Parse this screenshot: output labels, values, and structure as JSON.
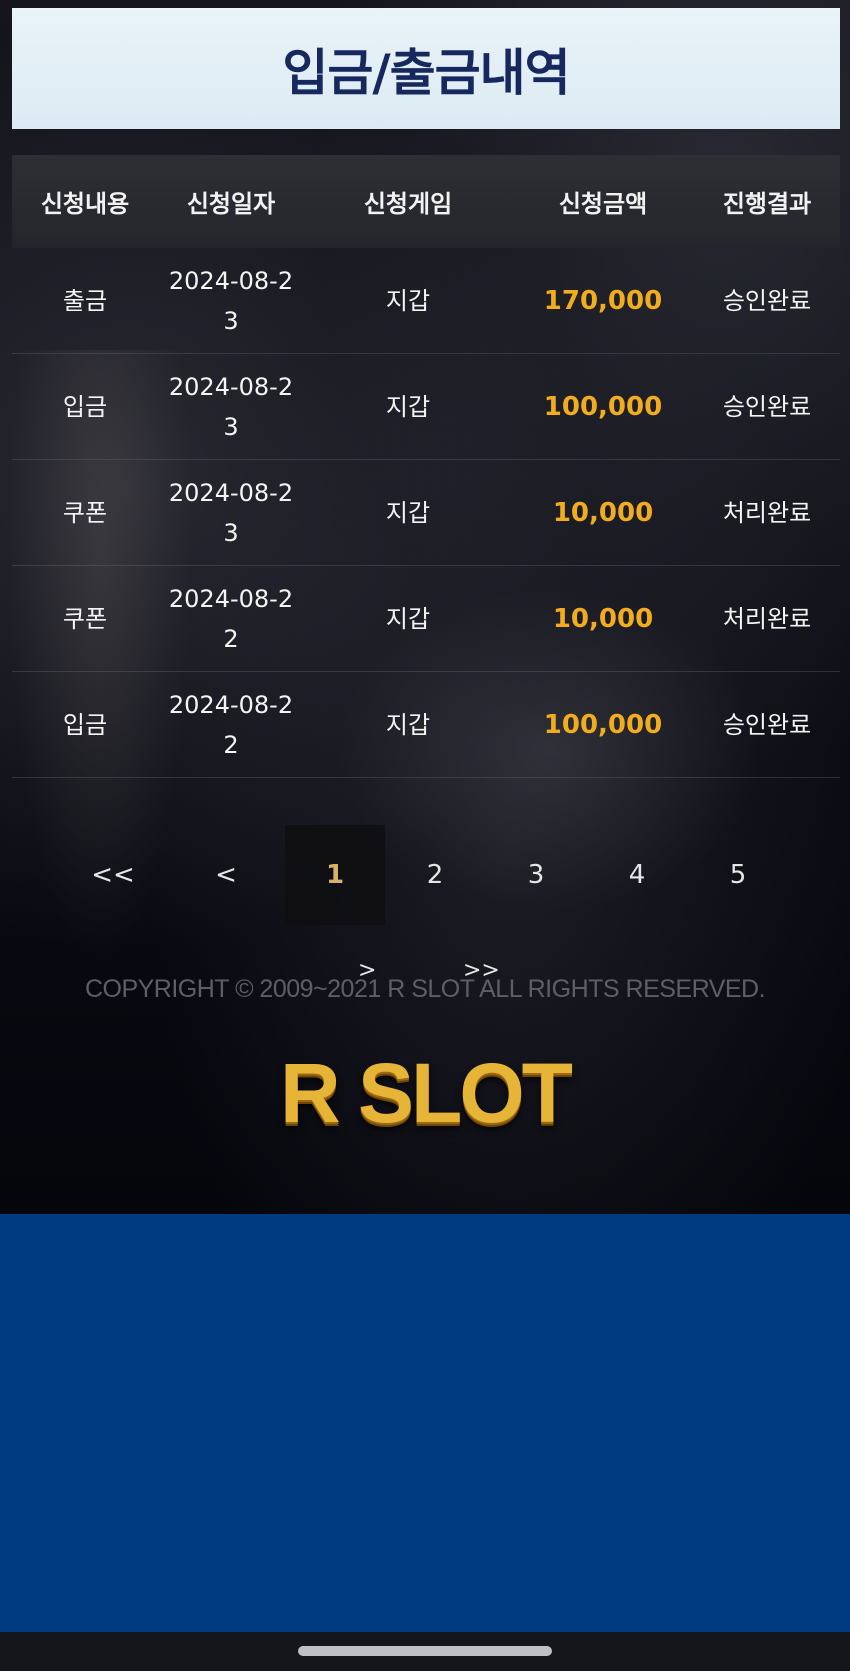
{
  "header": {
    "title": "입금/출금내역"
  },
  "table": {
    "columns": [
      "신청내용",
      "신청일자",
      "신청게임",
      "신청금액",
      "진행결과"
    ],
    "rows": [
      {
        "type": "출금",
        "date": "2024-08-23",
        "game": "지갑",
        "amount": "170,000",
        "status": "승인완료"
      },
      {
        "type": "입금",
        "date": "2024-08-23",
        "game": "지갑",
        "amount": "100,000",
        "status": "승인완료"
      },
      {
        "type": "쿠폰",
        "date": "2024-08-23",
        "game": "지갑",
        "amount": "10,000",
        "status": "처리완료"
      },
      {
        "type": "쿠폰",
        "date": "2024-08-22",
        "game": "지갑",
        "amount": "10,000",
        "status": "처리완료"
      },
      {
        "type": "입금",
        "date": "2024-08-22",
        "game": "지갑",
        "amount": "100,000",
        "status": "승인완료"
      }
    ]
  },
  "pagination": {
    "first": "<<",
    "prev": "<",
    "pages": [
      "1",
      "2",
      "3",
      "4",
      "5"
    ],
    "active_page": "1",
    "next": ">",
    "last": ">>"
  },
  "footer": {
    "copyright": "COPYRIGHT © 2009~2021 R SLOT ALL RIGHTS RESERVED.",
    "logo_text": "R SLOT"
  },
  "colors": {
    "title": "#17285e",
    "amount": "#f2ad1e",
    "bottom_panel": "#003a80"
  }
}
